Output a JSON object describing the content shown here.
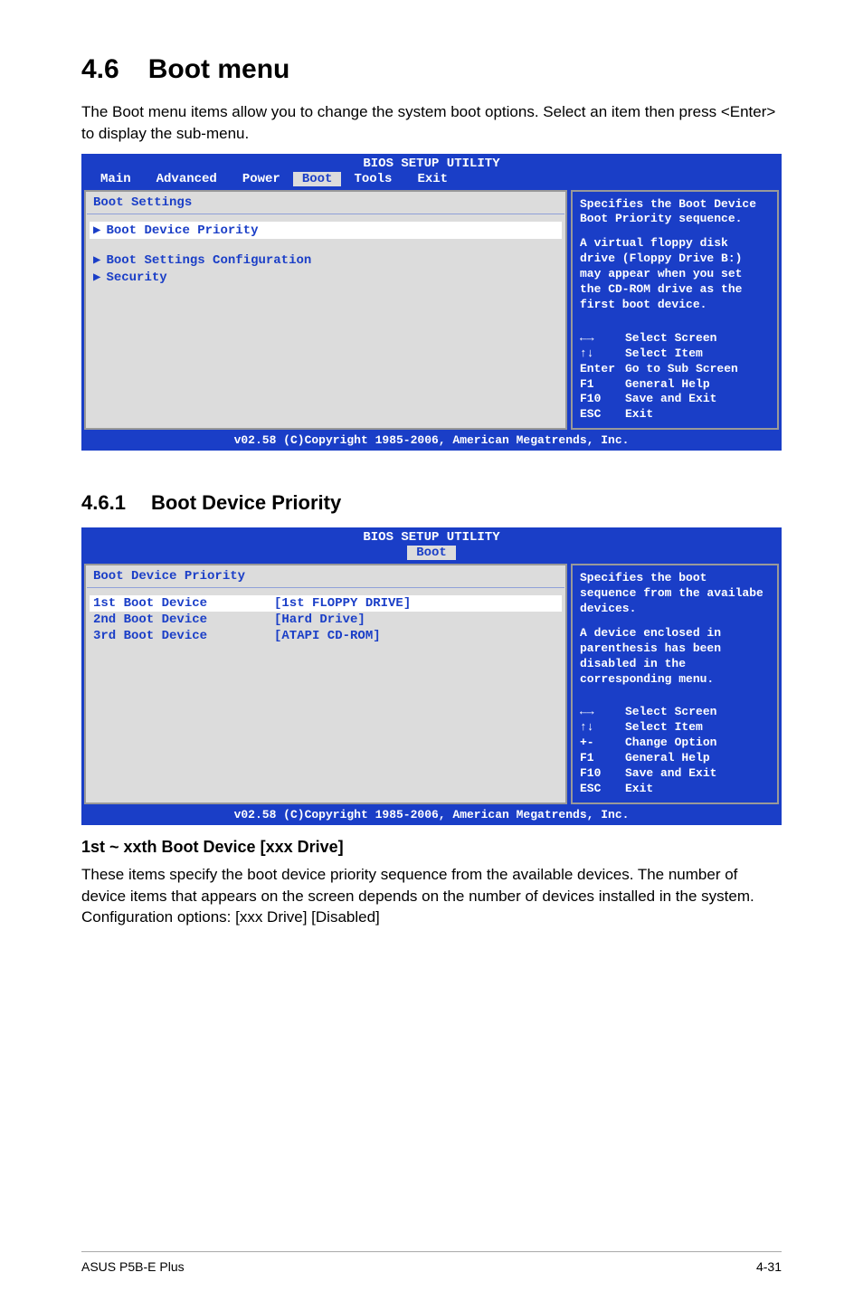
{
  "heading": {
    "num": "4.6",
    "title": "Boot menu"
  },
  "intro": "The Boot menu items allow you to change the system boot options. Select an item then press <Enter> to display the sub-menu.",
  "bios1": {
    "title": "BIOS SETUP UTILITY",
    "tabs": [
      "Main",
      "Advanced",
      "Power",
      "Boot",
      "Tools",
      "Exit"
    ],
    "active_tab": 3,
    "left_heading": "Boot Settings",
    "items": [
      {
        "label": "Boot Device Priority",
        "selected": true
      },
      {
        "label": "Boot Settings Configuration",
        "selected": false
      },
      {
        "label": "Security",
        "selected": false
      }
    ],
    "help1": "Specifies the Boot Device Boot Priority sequence.",
    "help2": "A virtual floppy disk drive (Floppy Drive B:) may appear when you set the CD-ROM drive as the first boot device.",
    "nav": [
      {
        "key": "←→",
        "action": "Select Screen"
      },
      {
        "key": "↑↓",
        "action": "Select Item"
      },
      {
        "key": "Enter",
        "action": "Go to Sub Screen"
      },
      {
        "key": "F1",
        "action": "General Help"
      },
      {
        "key": "F10",
        "action": "Save and Exit"
      },
      {
        "key": "ESC",
        "action": "Exit"
      }
    ],
    "status": "v02.58 (C)Copyright 1985-2006, American Megatrends, Inc."
  },
  "sub": {
    "num": "4.6.1",
    "title": "Boot Device Priority"
  },
  "bios2": {
    "title": "BIOS SETUP UTILITY",
    "active_tab_label": "Boot",
    "left_heading": "Boot Device Priority",
    "rows": [
      {
        "label": "1st Boot Device",
        "value": "[1st FLOPPY DRIVE]",
        "selected": true
      },
      {
        "label": "2nd Boot Device",
        "value": "[Hard Drive]",
        "selected": false
      },
      {
        "label": "3rd Boot Device",
        "value": "[ATAPI CD-ROM]",
        "selected": false
      }
    ],
    "help1": "Specifies the boot sequence from the availabe devices.",
    "help2": "A device enclosed in parenthesis has been disabled in the corresponding menu.",
    "nav": [
      {
        "key": "←→",
        "action": "Select Screen"
      },
      {
        "key": "↑↓",
        "action": "Select Item"
      },
      {
        "key": "+-",
        "action": "Change Option"
      },
      {
        "key": "F1",
        "action": "General Help"
      },
      {
        "key": "F10",
        "action": "Save and Exit"
      },
      {
        "key": "ESC",
        "action": "Exit"
      }
    ],
    "status": "v02.58 (C)Copyright 1985-2006, American Megatrends, Inc."
  },
  "para_heading": "1st ~ xxth Boot Device [xxx Drive]",
  "para_body": "These items specify the boot device priority sequence from the available devices. The number of device items that appears on the screen depends on the number of devices installed in the system. Configuration options: [xxx Drive] [Disabled]",
  "footer_left": "ASUS P5B-E Plus",
  "footer_right": "4-31"
}
